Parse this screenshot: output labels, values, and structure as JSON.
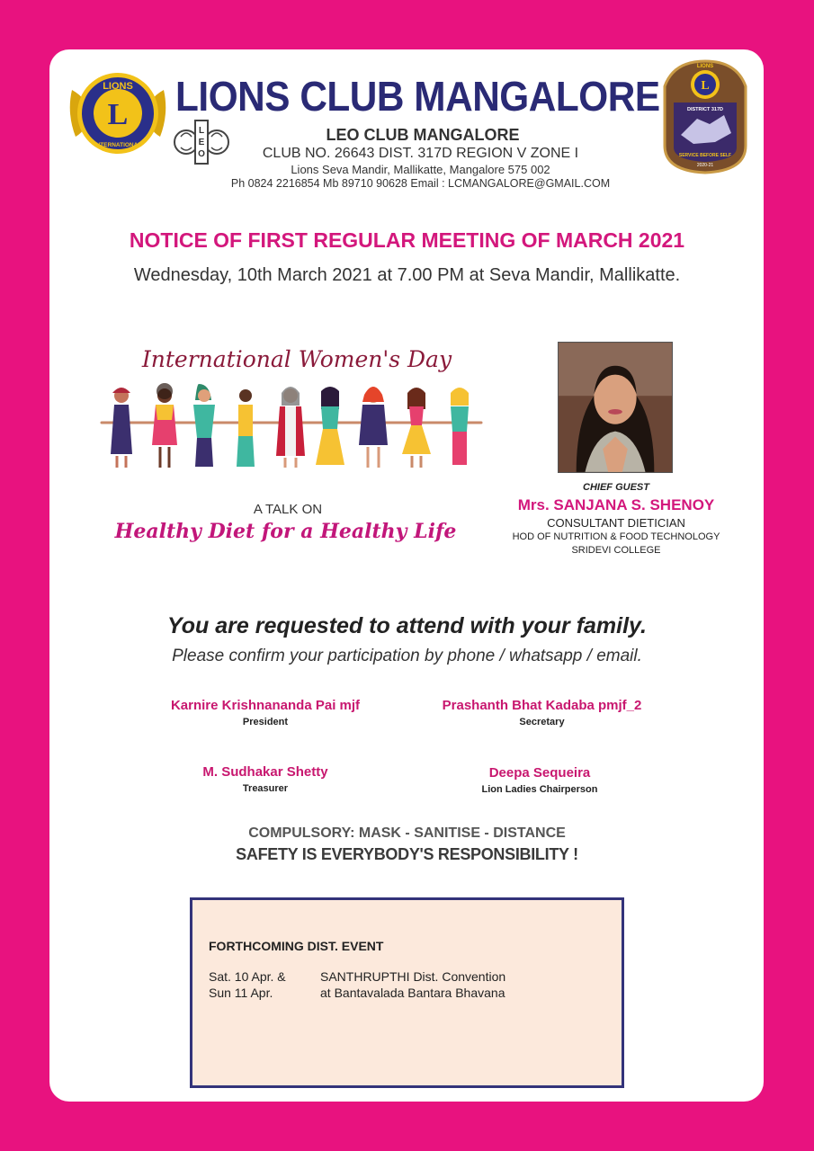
{
  "header": {
    "title": "LIONS CLUB MANGALORE",
    "subtitle": "LEO CLUB MANGALORE",
    "club_no": "CLUB NO. 26643  DIST. 317D  REGION V  ZONE I",
    "address": "Lions Seva Mandir, Mallikatte, Mangalore 575 002",
    "contact": "Ph 0824 2216854  Mb 89710 90628   Email : LCMANGALORE@GMAIL.COM",
    "logo_left_top": "LIONS",
    "logo_left_bottom": "INTERNATIONAL",
    "leo_logo_text": "LEO",
    "logo_right_top": "LIONS",
    "logo_right_district": "DISTRICT 317D",
    "logo_right_motto": "SERVICE BEFORE SELF",
    "logo_right_year": "2020-21"
  },
  "notice": {
    "title": "NOTICE OF FIRST REGULAR MEETING OF MARCH 2021",
    "when": "Wednesday, 10th March 2021 at 7.00 PM at Seva Mandir, Mallikatte."
  },
  "talk": {
    "banner_title": "International Women's Day",
    "intro": "A TALK ON",
    "title": "Healthy Diet for a Healthy Life"
  },
  "chief_guest": {
    "label": "CHIEF GUEST",
    "name": "Mrs. SANJANA S. SHENOY",
    "line1": "CONSULTANT DIETICIAN",
    "line2": "HOD OF NUTRITION & FOOD TECHNOLOGY",
    "line3": "SRIDEVI COLLEGE"
  },
  "request": {
    "main": "You are requested to attend with your family.",
    "confirm": "Please confirm your participation by phone / whatsapp / email."
  },
  "officers": [
    {
      "name": "Karnire Krishnananda Pai mjf",
      "role": "President"
    },
    {
      "name": "Prashanth Bhat Kadaba pmjf_2",
      "role": "Secretary"
    },
    {
      "name": "M. Sudhakar Shetty",
      "role": "Treasurer"
    },
    {
      "name": "Deepa Sequeira",
      "role": "Lion Ladies Chairperson"
    }
  ],
  "safety": {
    "compulsory": "COMPULSORY: MASK - SANITISE - DISTANCE",
    "responsibility": "SAFETY IS EVERYBODY'S RESPONSIBILITY !"
  },
  "event": {
    "heading": "FORTHCOMING DIST. EVENT",
    "date_line1": "Sat. 10 Apr. &",
    "date_line2": "Sun 11 Apr.",
    "desc_line1": "SANTHRUPTHI Dist. Convention",
    "desc_line2": "at Bantavalada Bantara Bhavana"
  },
  "colors": {
    "border_pink": "#e8127f",
    "title_navy": "#2a2a75",
    "accent_magenta": "#d3177c",
    "event_bg": "#fce9dc"
  }
}
